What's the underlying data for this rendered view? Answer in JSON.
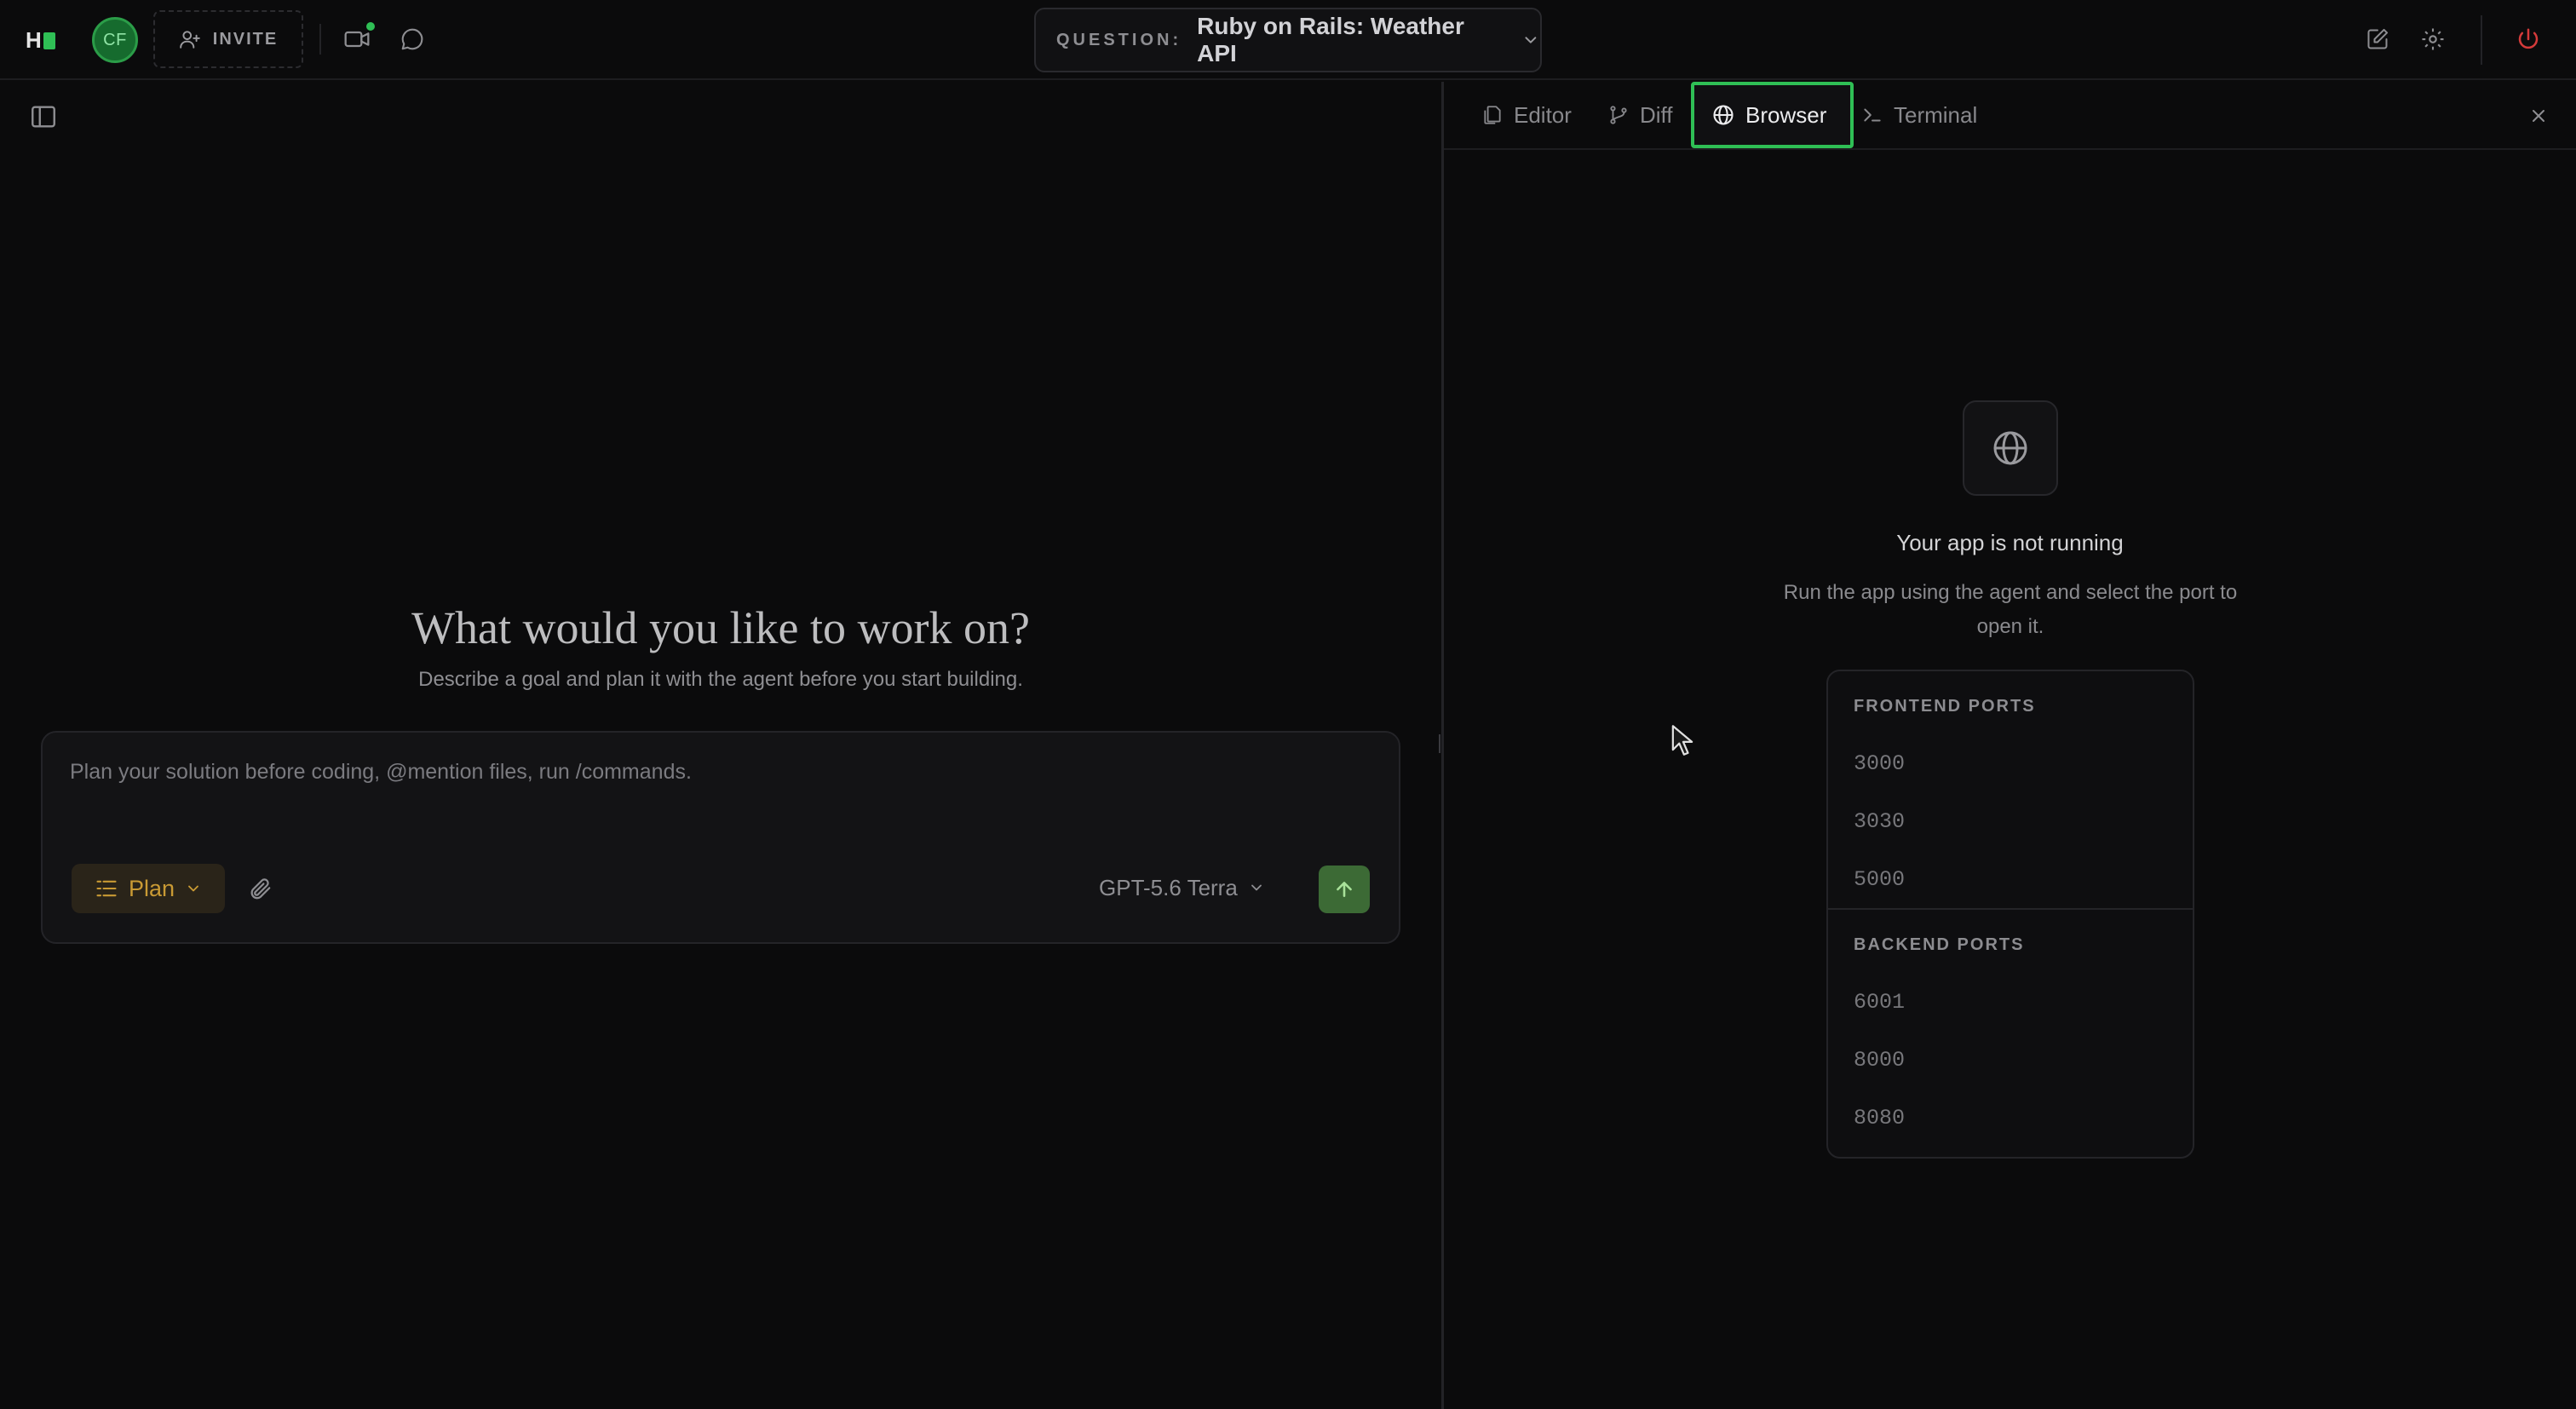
{
  "topbar": {
    "logo_text": "H",
    "avatar_initials": "CF",
    "invite_label": "INVITE",
    "question_label": "QUESTION:",
    "question_title": "Ruby on Rails: Weather API",
    "icons": [
      "video-icon",
      "chat-icon",
      "edit-icon",
      "gear-icon",
      "power-icon"
    ],
    "accent_color": "#2fbf55",
    "power_color": "#d43a3a"
  },
  "left": {
    "title": "What would you like to work on?",
    "subtitle": "Describe a goal and plan it with the agent before you start building.",
    "composer": {
      "placeholder": "Plan your solution before coding, @mention files, run /commands.",
      "value": "",
      "mode_label": "Plan",
      "model_label": "GPT-5.6 Terra"
    }
  },
  "right": {
    "tabs": [
      {
        "label": "Editor",
        "icon": "files-icon",
        "active": false
      },
      {
        "label": "Diff",
        "icon": "branch-icon",
        "active": false
      },
      {
        "label": "Browser",
        "icon": "globe-icon",
        "active": true
      },
      {
        "label": "Terminal",
        "icon": "terminal-icon",
        "active": false
      }
    ],
    "status_title": "Your app is not running",
    "status_desc": "Run the app using the agent and select the port to open it.",
    "frontend_ports_label": "FRONTEND PORTS",
    "frontend_ports": [
      "3000",
      "3030",
      "5000"
    ],
    "backend_ports_label": "BACKEND PORTS",
    "backend_ports": [
      "6001",
      "8000",
      "8080"
    ]
  }
}
